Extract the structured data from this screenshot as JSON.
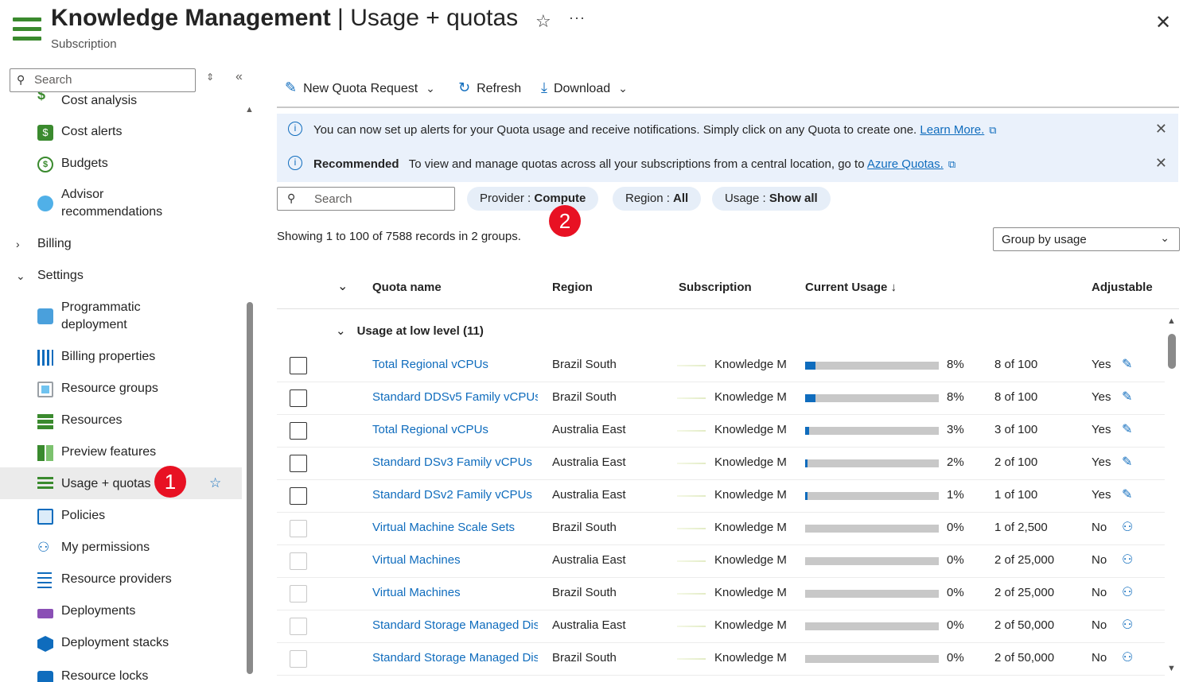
{
  "header": {
    "title_main": "Knowledge Management",
    "title_sep": " | ",
    "title_page": "Usage + quotas",
    "subtitle": "Subscription",
    "favorite_icon": "☆",
    "more_icon": "···",
    "close_icon": "✕"
  },
  "sidebar": {
    "search_placeholder": "Search",
    "items": [
      {
        "label": "Cost analysis"
      },
      {
        "label": "Cost alerts"
      },
      {
        "label": "Budgets"
      },
      {
        "label": "Advisor recommendations"
      },
      {
        "label": "Billing"
      },
      {
        "label": "Settings"
      },
      {
        "label": "Programmatic deployment"
      },
      {
        "label": "Billing properties"
      },
      {
        "label": "Resource groups"
      },
      {
        "label": "Resources"
      },
      {
        "label": "Preview features"
      },
      {
        "label": "Usage + quotas"
      },
      {
        "label": "Policies"
      },
      {
        "label": "My permissions"
      },
      {
        "label": "Resource providers"
      },
      {
        "label": "Deployments"
      },
      {
        "label": "Deployment stacks"
      },
      {
        "label": "Resource locks"
      }
    ]
  },
  "annotations": {
    "badge1": "1",
    "badge2": "2"
  },
  "toolbar": {
    "new_quota": "New Quota Request",
    "refresh": "Refresh",
    "download": "Download"
  },
  "banners": {
    "alerts_text": "You can now set up alerts for your Quota usage and receive notifications. Simply click on any Quota to create one.",
    "alerts_link": "Learn More.",
    "rec_bold": "Recommended",
    "rec_text": "To view and manage quotas across all your subscriptions from a central location, go to",
    "rec_link": "Azure Quotas."
  },
  "filters": {
    "search_placeholder": "Search",
    "provider_label": "Provider : ",
    "provider_value": "Compute",
    "region_label": "Region : ",
    "region_value": "All",
    "usage_label": "Usage : ",
    "usage_value": "Show all"
  },
  "showing": "Showing 1 to 100 of 7588 records in 2 groups.",
  "group_by": "Group by usage",
  "table": {
    "headers": {
      "quota_name": "Quota name",
      "region": "Region",
      "subscription": "Subscription",
      "current_usage": "Current Usage ↓",
      "adjustable": "Adjustable"
    },
    "group_label": "Usage at low level (11)",
    "rows": [
      {
        "name": "Total Regional vCPUs",
        "region": "Brazil South",
        "sub": "Knowledge Management",
        "pct": 8,
        "pct_text": "8%",
        "count": "8 of 100",
        "adj": "Yes",
        "action_icon": "pencil-icon",
        "enabled": true
      },
      {
        "name": "Standard DDSv5 Family vCPUs",
        "region": "Brazil South",
        "sub": "Knowledge Management",
        "pct": 8,
        "pct_text": "8%",
        "count": "8 of 100",
        "adj": "Yes",
        "action_icon": "pencil-icon",
        "enabled": true
      },
      {
        "name": "Total Regional vCPUs",
        "region": "Australia East",
        "sub": "Knowledge Management",
        "pct": 3,
        "pct_text": "3%",
        "count": "3 of 100",
        "adj": "Yes",
        "action_icon": "pencil-icon",
        "enabled": true
      },
      {
        "name": "Standard DSv3 Family vCPUs",
        "region": "Australia East",
        "sub": "Knowledge Management",
        "pct": 2,
        "pct_text": "2%",
        "count": "2 of 100",
        "adj": "Yes",
        "action_icon": "pencil-icon",
        "enabled": true
      },
      {
        "name": "Standard DSv2 Family vCPUs",
        "region": "Australia East",
        "sub": "Knowledge Management",
        "pct": 1,
        "pct_text": "1%",
        "count": "1 of 100",
        "adj": "Yes",
        "action_icon": "pencil-icon",
        "enabled": true
      },
      {
        "name": "Virtual Machine Scale Sets",
        "region": "Brazil South",
        "sub": "Knowledge Management",
        "pct": 0,
        "pct_text": "0%",
        "count": "1 of 2,500",
        "adj": "No",
        "action_icon": "person-icon",
        "enabled": false
      },
      {
        "name": "Virtual Machines",
        "region": "Australia East",
        "sub": "Knowledge Management",
        "pct": 0,
        "pct_text": "0%",
        "count": "2 of 25,000",
        "adj": "No",
        "action_icon": "person-icon",
        "enabled": false
      },
      {
        "name": "Virtual Machines",
        "region": "Brazil South",
        "sub": "Knowledge Management",
        "pct": 0,
        "pct_text": "0%",
        "count": "2 of 25,000",
        "adj": "No",
        "action_icon": "person-icon",
        "enabled": false
      },
      {
        "name": "Standard Storage Managed Disks",
        "region": "Australia East",
        "sub": "Knowledge Management",
        "pct": 0,
        "pct_text": "0%",
        "count": "2 of 50,000",
        "adj": "No",
        "action_icon": "person-icon",
        "enabled": false
      },
      {
        "name": "Standard Storage Managed Disks",
        "region": "Brazil South",
        "sub": "Knowledge Management",
        "pct": 0,
        "pct_text": "0%",
        "count": "2 of 50,000",
        "adj": "No",
        "action_icon": "person-icon",
        "enabled": false
      }
    ]
  },
  "colors": {
    "accent": "#0f6cbd",
    "badge": "#e81123",
    "banner": "#eaf1fb",
    "brand_green": "#3a8a2e"
  }
}
